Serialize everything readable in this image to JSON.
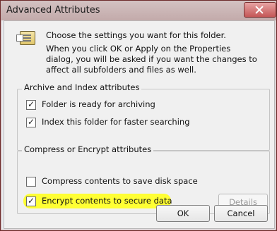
{
  "window": {
    "title": "Advanced Attributes"
  },
  "intro": {
    "line1": "Choose the settings you want for this folder.",
    "line2": "When you click OK or Apply on the Properties dialog, you will be asked if you want the changes to affect all subfolders and files as well."
  },
  "archive_group": {
    "legend": "Archive and Index attributes",
    "options": [
      {
        "label": "Folder is ready for archiving",
        "checked": true
      },
      {
        "label": "Index this folder for faster searching",
        "checked": true
      }
    ]
  },
  "compress_group": {
    "legend": "Compress or Encrypt attributes",
    "options": [
      {
        "label": "Compress contents to save disk space",
        "checked": false
      },
      {
        "label": "Encrypt contents to secure data",
        "checked": true
      }
    ],
    "details_label": "Details"
  },
  "buttons": {
    "ok": "OK",
    "cancel": "Cancel"
  }
}
